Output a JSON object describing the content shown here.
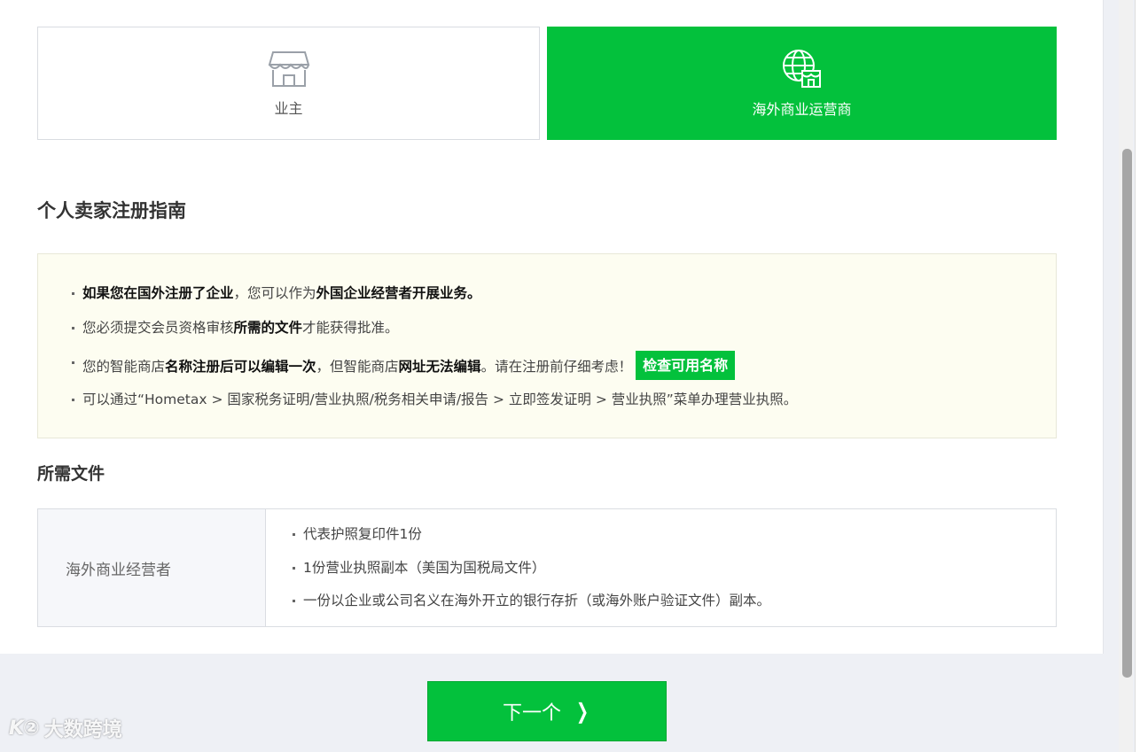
{
  "seller_types": [
    {
      "label": "业主",
      "icon": "storefront-icon",
      "selected": false
    },
    {
      "label": "海外商业运营商",
      "icon": "globe-store-icon",
      "selected": true
    }
  ],
  "guide": {
    "title": "个人卖家注册指南",
    "items": [
      {
        "parts": [
          {
            "t": "如果您在国外注册了企业",
            "b": true
          },
          {
            "t": "，您可以作为",
            "b": false
          },
          {
            "t": "外国企业经营者开展业务。",
            "b": true
          }
        ]
      },
      {
        "parts": [
          {
            "t": "您必须提交会员资格审核",
            "b": false
          },
          {
            "t": "所需的文件",
            "b": true
          },
          {
            "t": "才能获得批准。",
            "b": false
          }
        ]
      },
      {
        "parts": [
          {
            "t": "您的智能商店",
            "b": false
          },
          {
            "t": "名称注册后可以编辑一次",
            "b": true
          },
          {
            "t": "，但智能商店",
            "b": false
          },
          {
            "t": "网址无法编辑",
            "b": true
          },
          {
            "t": "。请在注册前仔细考虑！",
            "b": false
          }
        ]
      },
      {
        "parts": [
          {
            "t": "可以通过“Hometax > 国家税务证明/营业执照/税务相关申请/报告 > 立即签发证明 > 营业执照”菜单办理营业执照。",
            "b": false
          }
        ]
      }
    ],
    "check_name_button": "检查可用名称"
  },
  "documents": {
    "title": "所需文件",
    "row_header": "海外商业经营者",
    "items": [
      "代表护照复印件1份",
      "1份营业执照副本（美国为国税局文件）",
      "一份以企业或公司名义在海外开立的银行存折（或海外账户验证文件）副本。"
    ]
  },
  "next_button": "下一个",
  "watermark": {
    "logo": "K②",
    "text": "大数跨境"
  },
  "colors": {
    "accent": "#03c13c",
    "notice_bg": "#fdfdf1"
  }
}
